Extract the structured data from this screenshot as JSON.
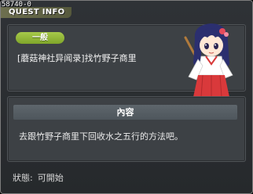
{
  "quest": {
    "id": "58740-0",
    "window_title": "QUEST INFO",
    "category": "一般",
    "name": "[蘑菇神社异闻录]找竹野子商里"
  },
  "content": {
    "header": "內容",
    "description": "去跟竹野子商里下回收水之五行的方法吧。"
  },
  "status": {
    "label": "狀態:",
    "value": "可開始"
  },
  "colors": {
    "window_bg": "#2f3236",
    "panel_bg": "#3d4145",
    "category_pill": "#94b93a",
    "header_bar": "#575f65"
  }
}
